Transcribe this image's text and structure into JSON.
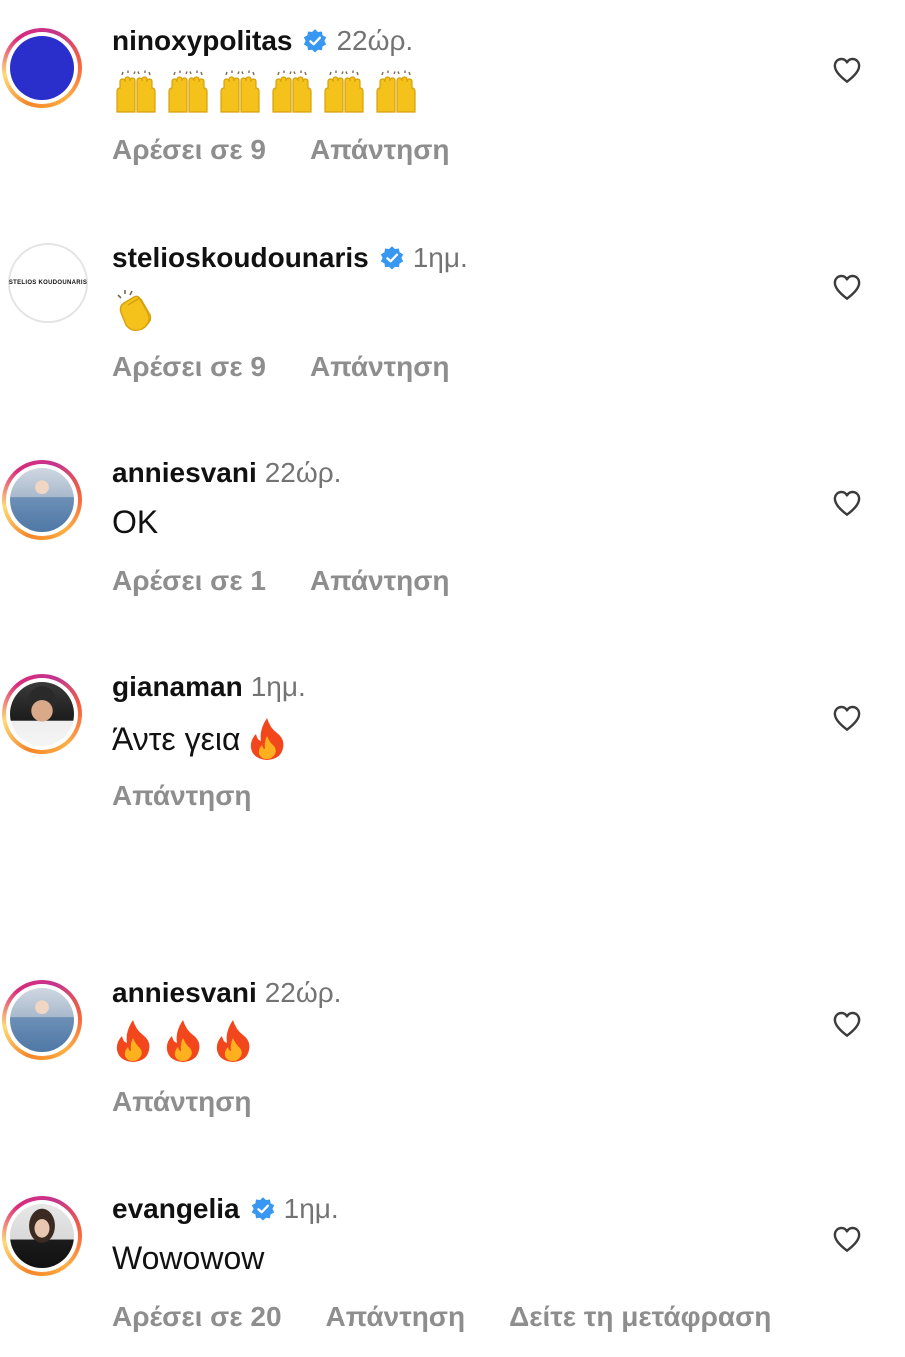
{
  "colors": {
    "accent_blue": "#3897f0",
    "muted_text": "#8e8e8e",
    "time_text": "#737373"
  },
  "comments": [
    {
      "username": "ninoxypolitas",
      "verified": true,
      "time": "22ώρ.",
      "text_emojis": "raising-hands x6",
      "likes_label": "Αρέσει σε 9",
      "reply_label": "Απάντηση",
      "avatar": "blue-circle"
    },
    {
      "username": "stelioskoudounaris",
      "verified": true,
      "time": "1ημ.",
      "text_emojis": "clapping-hands",
      "likes_label": "Αρέσει σε 9",
      "reply_label": "Απάντηση",
      "avatar_logo": "STELIOS KOUDOUNARIS"
    },
    {
      "username": "anniesvani",
      "verified": false,
      "time": "22ώρ.",
      "text": "OK",
      "likes_label": "Αρέσει σε 1",
      "reply_label": "Απάντηση"
    },
    {
      "username": "gianaman",
      "verified": false,
      "time": "1ημ.",
      "text": "Άντε γεια",
      "text_emojis": "fire",
      "reply_label": "Απάντηση"
    },
    {
      "username": "anniesvani",
      "verified": false,
      "time": "22ώρ.",
      "text_emojis": "fire x3",
      "reply_label": "Απάντηση"
    },
    {
      "username": "evangelia",
      "verified": true,
      "time": "1ημ.",
      "text": "Wowowow",
      "likes_label": "Αρέσει σε 20",
      "reply_label": "Απάντηση",
      "translate_label": "Δείτε τη μετάφραση"
    }
  ],
  "icons": {
    "like": "heart-outline-icon",
    "verified": "verified-badge-icon"
  }
}
